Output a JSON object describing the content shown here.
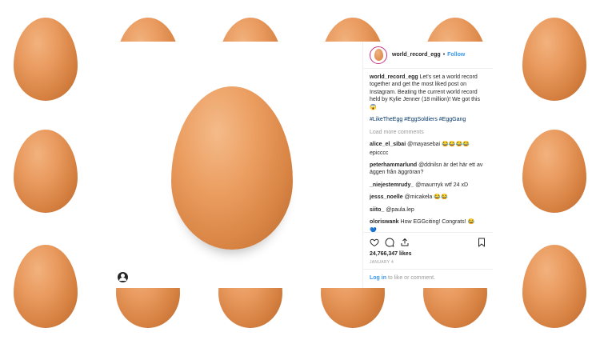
{
  "post": {
    "username": "world_record_egg",
    "separator": "•",
    "follow_label": "Follow",
    "caption_user": "world_record_egg",
    "caption_text": "Let's set a world record together and get the most liked post on Instagram. Beating the current world record held by Kylie Jenner (18 million)! We got this 😱",
    "hashtags": "#LikeTheEgg #EggSoldiers #EggGang",
    "load_more": "Load more comments",
    "comments": [
      {
        "user": "alice_el_sibai",
        "text": "@mayasebai 😂😂😂😂"
      },
      {
        "user": "",
        "text": "epicccc"
      },
      {
        "user": "peterhammarlund",
        "text": "@ddnilsn är det här ett av äggen från äggröran?"
      },
      {
        "user": "_niejestemrudy_",
        "text": "@maurrryk wtf 24 xD"
      },
      {
        "user": "jesss_noelle",
        "text": "@micakela 😂😂"
      },
      {
        "user": "siito_",
        "text": "@paula.lep"
      },
      {
        "user": "oloriswank",
        "text": "How EGGciting! Congrats! 😂"
      },
      {
        "user": "",
        "text": "💙"
      }
    ],
    "likes": "24,766,347 likes",
    "date": "JANUARY 4",
    "add_comment_login": "Log in",
    "add_comment_rest": " to like or comment."
  },
  "icons": {
    "heart": "heart-icon",
    "comment": "comment-icon",
    "share": "share-icon",
    "save": "bookmark-icon",
    "tag": "user-tag-icon"
  },
  "colors": {
    "accent": "#3897f0",
    "egg": "#e99a5e"
  }
}
